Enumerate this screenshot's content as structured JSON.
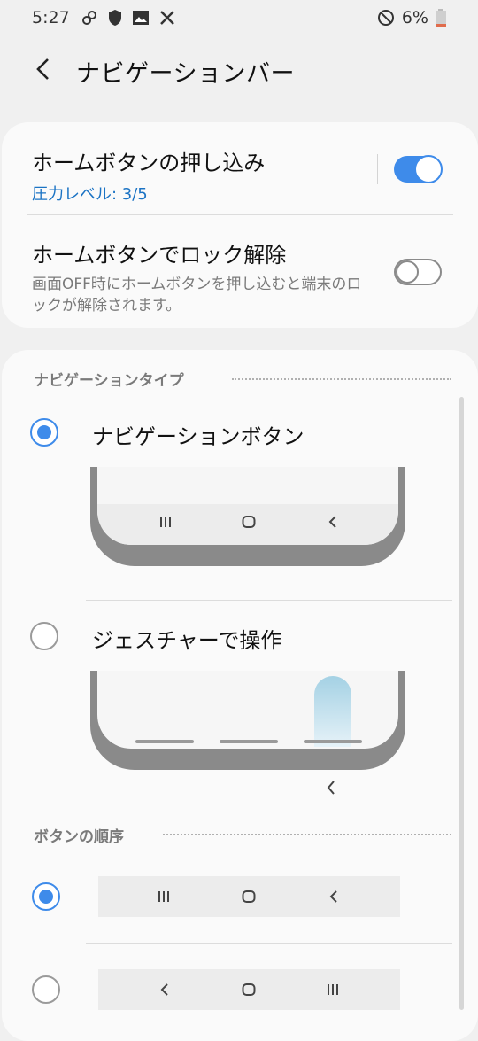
{
  "status_bar": {
    "time": "5:27",
    "battery": "6%",
    "icons": [
      "link-icon",
      "shield-icon",
      "image-icon",
      "tools-icon",
      "dnd-icon",
      "battery-icon"
    ]
  },
  "header": {
    "title": "ナビゲーションバー",
    "back_icon": "back-arrow-icon"
  },
  "home_button": {
    "press_title": "ホームボタンの押し込み",
    "press_sub": "圧力レベル: 3/5",
    "press_enabled": true,
    "unlock_title": "ホームボタンでロック解除",
    "unlock_sub": "画面OFF時にホームボタンを押し込むと端末のロックが解除されます。",
    "unlock_enabled": false
  },
  "nav_type": {
    "header": "ナビゲーションタイプ",
    "options": [
      {
        "label": "ナビゲーションボタン",
        "selected": true
      },
      {
        "label": "ジェスチャーで操作",
        "selected": false
      }
    ]
  },
  "button_order": {
    "header": "ボタンの順序",
    "options": [
      {
        "icons": [
          "recents-icon",
          "home-icon",
          "back-icon"
        ],
        "selected": true
      },
      {
        "icons": [
          "back-icon",
          "home-icon",
          "recents-icon"
        ],
        "selected": false
      }
    ]
  },
  "colors": {
    "accent": "#3e8bea",
    "link_blue": "#1b73c4",
    "background": "#f0f0f0",
    "card": "#fafafa"
  }
}
